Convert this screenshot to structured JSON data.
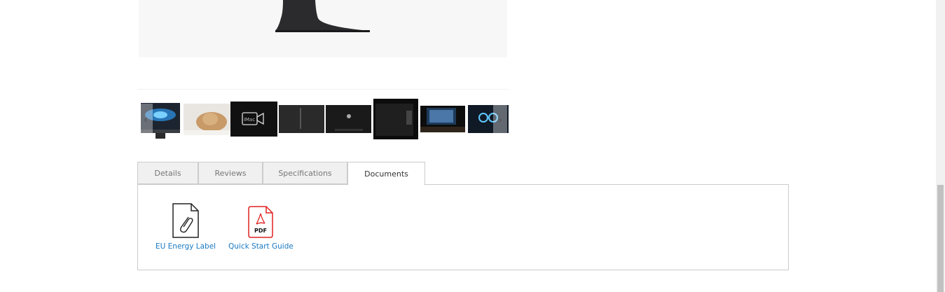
{
  "gallery": {
    "prev_arrow": "‹",
    "next_arrow": "›",
    "thumbnails": [
      {
        "name": "thumb-imac-front"
      },
      {
        "name": "thumb-cat"
      },
      {
        "name": "thumb-video"
      },
      {
        "name": "thumb-imac-side"
      },
      {
        "name": "thumb-imac-back"
      },
      {
        "name": "thumb-imac-ports"
      },
      {
        "name": "thumb-imac-desk"
      },
      {
        "name": "thumb-imac-screen"
      }
    ]
  },
  "tabs": [
    {
      "label": "Details",
      "active": false
    },
    {
      "label": "Reviews",
      "active": false
    },
    {
      "label": "Specifications",
      "active": false
    },
    {
      "label": "Documents",
      "active": true
    }
  ],
  "documents": [
    {
      "label": "EU Energy Label",
      "icon": "paperclip-file-icon"
    },
    {
      "label": "Quick Start Guide",
      "icon": "pdf-file-icon",
      "badge": "PDF"
    }
  ],
  "colors": {
    "accent": "#f26322",
    "link": "#1979c3",
    "pdf_red": "#e02020"
  }
}
